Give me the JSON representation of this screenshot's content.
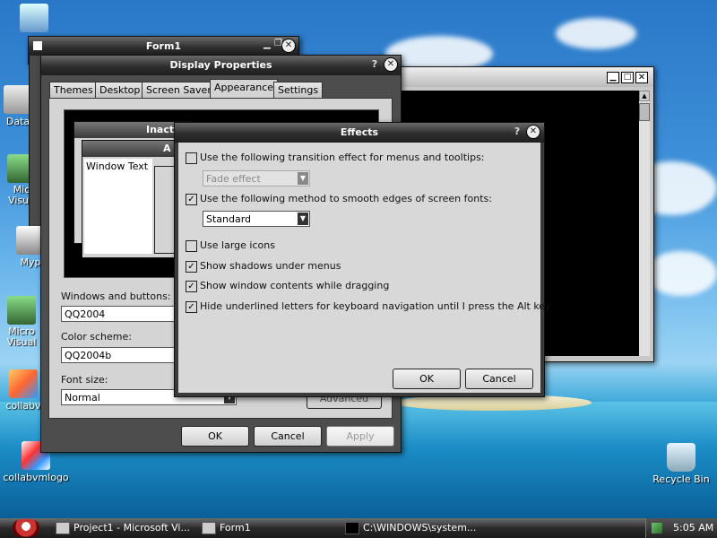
{
  "desktop_icons": [
    {
      "name": "icon-computer",
      "label": "Co"
    },
    {
      "name": "icon-data",
      "label": "Data"
    },
    {
      "name": "icon-microsoft-visual-1",
      "label": "Mic\nVisua"
    },
    {
      "name": "icon-myp",
      "label": "Myp"
    },
    {
      "name": "icon-microsoft-visual-2",
      "label": "Micro\nVisual"
    },
    {
      "name": "icon-collabvm",
      "label": "collabv"
    },
    {
      "name": "icon-collabvmlogo",
      "label": "collabvmlogo"
    },
    {
      "name": "icon-recycle-bin",
      "label": "Recycle Bin"
    }
  ],
  "form1": {
    "title": "Form1"
  },
  "display_properties": {
    "title": "Display Properties",
    "tabs": [
      "Themes",
      "Desktop",
      "Screen Saver",
      "Appearance",
      "Settings"
    ],
    "preview": {
      "inactive_label": "Inact",
      "active_label": "A",
      "window_text": "Window Text"
    },
    "windows_buttons_label": "Windows and buttons:",
    "windows_buttons_value": "QQ2004",
    "color_scheme_label": "Color scheme:",
    "color_scheme_value": "QQ2004b",
    "font_size_label": "Font size:",
    "font_size_value": "Normal",
    "advanced_label": "Advanced",
    "ok": "OK",
    "cancel": "Cancel",
    "apply": "Apply"
  },
  "effects": {
    "title": "Effects",
    "transition_label": "Use the following transition effect for menus and tooltips:",
    "transition_value": "Fade effect",
    "smooth_label": "Use the following method to smooth edges of screen fonts:",
    "smooth_value": "Standard",
    "large_icons": "Use large icons",
    "shadows": "Show shadows under menus",
    "drag_contents": "Show window contents while dragging",
    "hide_underline": "Hide underlined letters for keyboard navigation until I press the Alt key",
    "ok": "OK",
    "cancel": "Cancel"
  },
  "taskbar": {
    "items": [
      "Project1 - Microsoft Vi...",
      "Form1",
      "C:\\WINDOWS\\system..."
    ],
    "clock": "5:05 AM"
  }
}
